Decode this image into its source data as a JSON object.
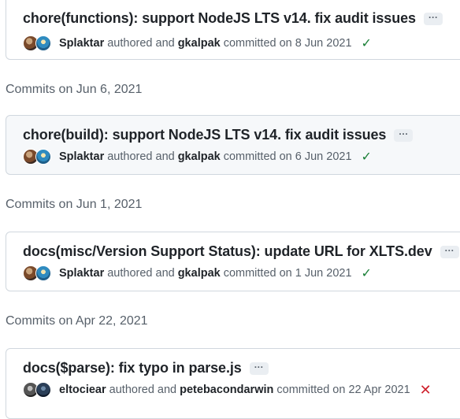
{
  "commits": [
    {
      "title": "chore(functions): support NodeJS LTS v14. fix audit issues",
      "author": "Splaktar",
      "authored_text": "authored and",
      "committer": "gkalpak",
      "committed_text": "committed on 8 Jun 2021",
      "status": "success",
      "status_glyph": "✓"
    },
    {
      "title": "chore(build): support NodeJS LTS v14. fix audit issues",
      "author": "Splaktar",
      "authored_text": "authored and",
      "committer": "gkalpak",
      "committed_text": "committed on 6 Jun 2021",
      "status": "success",
      "status_glyph": "✓"
    },
    {
      "title": "docs(misc/Version Support Status): update URL for XLTS.dev",
      "author": "Splaktar",
      "authored_text": "authored and",
      "committer": "gkalpak",
      "committed_text": "committed on 1 Jun 2021",
      "status": "success",
      "status_glyph": "✓"
    },
    {
      "title": "docs($parse): fix typo in parse.js",
      "author": "eltociear",
      "authored_text": "authored and",
      "committer": "petebacondarwin",
      "committed_text": "committed on 22 Apr 2021",
      "status": "failure",
      "status_glyph": "✕"
    }
  ],
  "date_headers": [
    "Commits on Jun 6, 2021",
    "Commits on Jun 1, 2021",
    "Commits on Apr 22, 2021"
  ],
  "ellipsis_label": "···",
  "colors": {
    "success": "#1a7f37",
    "failure": "#cf222e",
    "border": "#d0d7de",
    "muted": "#57606a"
  }
}
